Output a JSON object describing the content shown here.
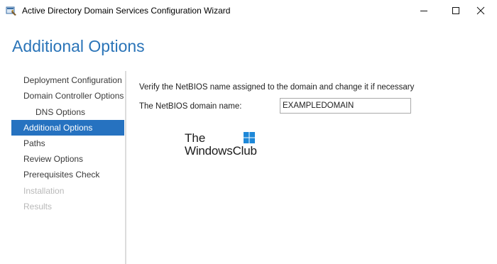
{
  "window": {
    "title": "Active Directory Domain Services Configuration Wizard",
    "controls": {
      "minimize_icon": "minimize-icon",
      "maximize_icon": "maximize-icon",
      "close_icon": "close-icon"
    }
  },
  "header": {
    "title": "Additional Options"
  },
  "sidebar": {
    "items": [
      {
        "label": "Deployment Configuration",
        "state": "normal"
      },
      {
        "label": "Domain Controller Options",
        "state": "normal"
      },
      {
        "label": "DNS Options",
        "state": "normal",
        "indent": true
      },
      {
        "label": "Additional Options",
        "state": "active"
      },
      {
        "label": "Paths",
        "state": "normal"
      },
      {
        "label": "Review Options",
        "state": "normal"
      },
      {
        "label": "Prerequisites Check",
        "state": "normal"
      },
      {
        "label": "Installation",
        "state": "disabled"
      },
      {
        "label": "Results",
        "state": "disabled"
      }
    ]
  },
  "main": {
    "instructions": "Verify the NetBIOS name assigned to the domain and change it if necessary",
    "netbios_label": "The NetBIOS domain name:",
    "netbios_value": "EXAMPLEDOMAIN"
  },
  "watermark": {
    "line1": "The",
    "line2": "WindowsClub"
  },
  "colors": {
    "accent": "#2672c0",
    "title": "#2a74b8",
    "disabled_text": "#b9b9b9"
  }
}
